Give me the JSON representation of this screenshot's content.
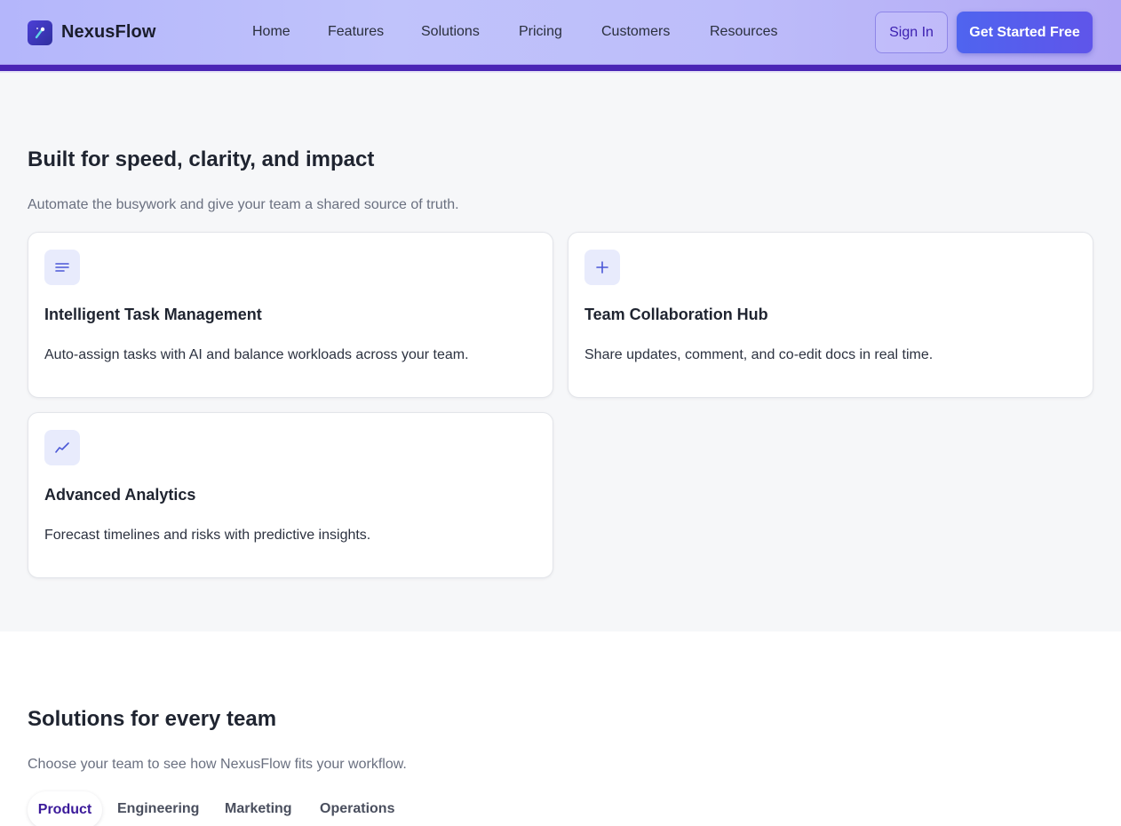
{
  "header": {
    "brand": "NexusFlow",
    "logo_icon": "sparkle-wand-icon",
    "nav": [
      "Home",
      "Features",
      "Solutions",
      "Pricing",
      "Customers",
      "Resources"
    ],
    "sign_in": "Sign In",
    "cta": "Get Started Free",
    "colors": {
      "accent": "#4f64ef",
      "brand_dark": "#4a25b5"
    }
  },
  "features": {
    "title": "Built for speed, clarity, and impact",
    "subtitle": "Automate the busywork and give your team a shared source of truth.",
    "cards": [
      {
        "icon": "lines-icon",
        "title": "Intelligent Task Management",
        "desc": "Auto-assign tasks with AI and balance workloads across your team."
      },
      {
        "icon": "plus-icon",
        "title": "Team Collaboration Hub",
        "desc": "Share updates, comment, and co-edit docs in real time."
      },
      {
        "icon": "trend-chart-icon",
        "title": "Advanced Analytics",
        "desc": "Forecast timelines and risks with predictive insights."
      }
    ]
  },
  "solutions": {
    "title": "Solutions for every team",
    "subtitle": "Choose your team to see how NexusFlow fits your workflow.",
    "tabs": [
      "Product",
      "Engineering",
      "Marketing",
      "Operations"
    ],
    "active_tab": "Product"
  }
}
